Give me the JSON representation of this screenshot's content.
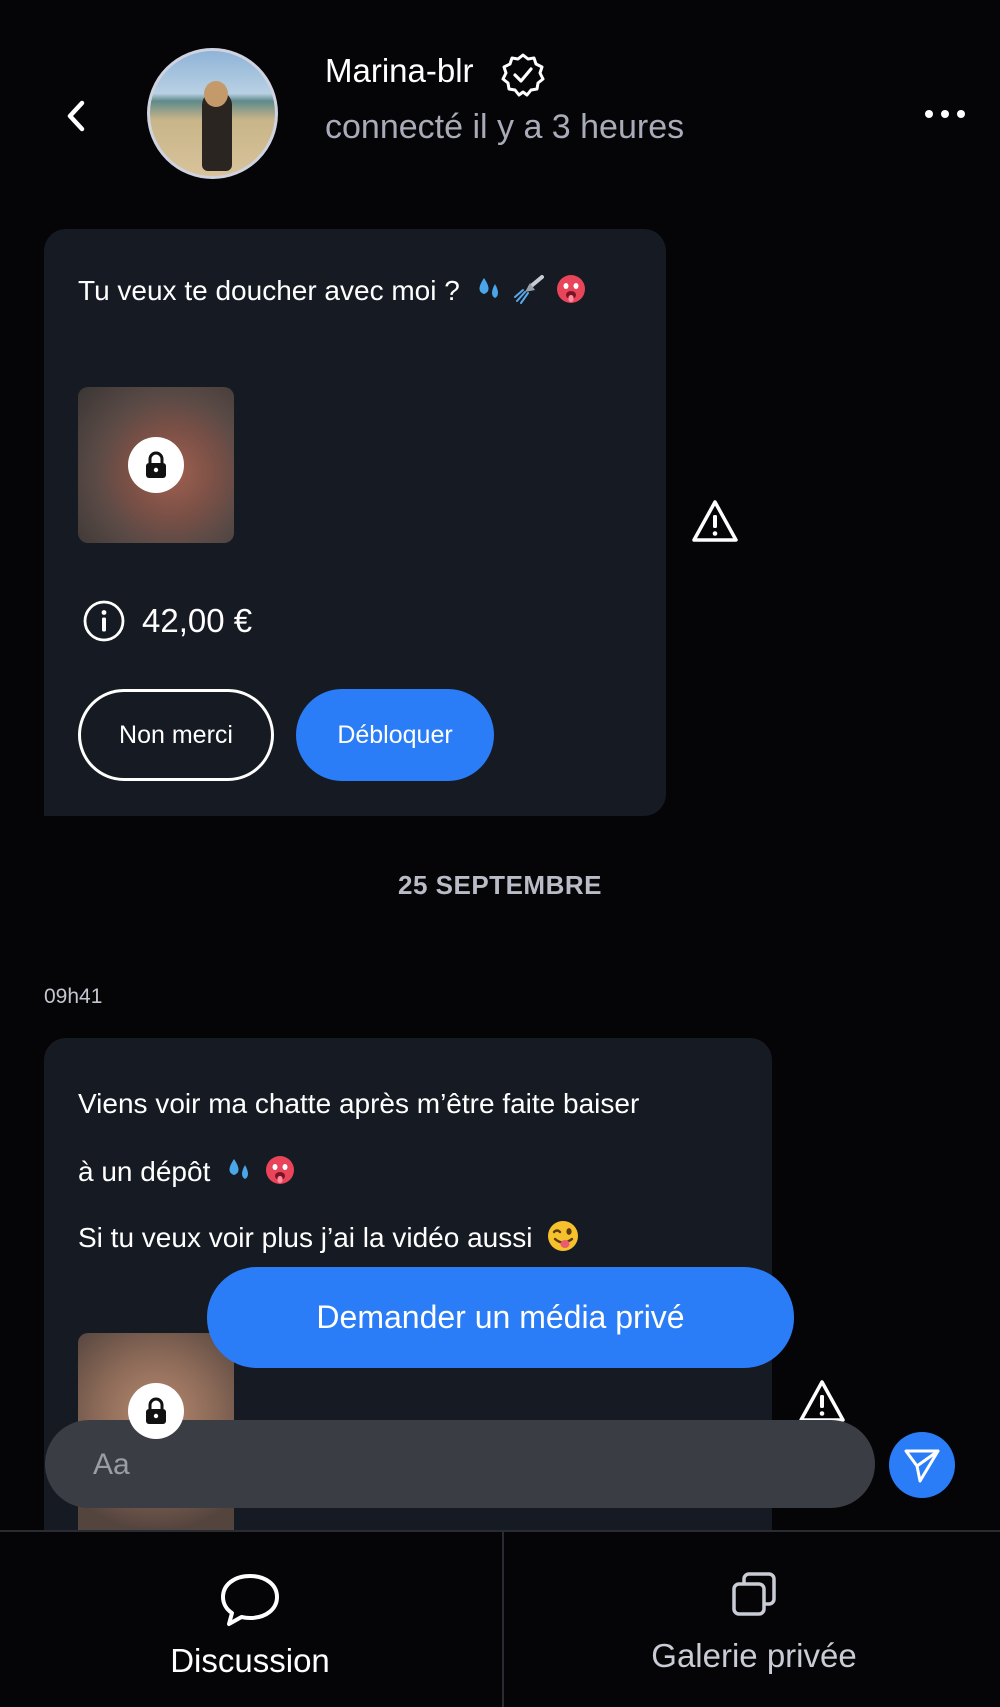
{
  "header": {
    "user_name": "Marina-blr",
    "status": "connecté il y a 3 heures"
  },
  "messages": [
    {
      "text": "Tu veux te doucher avec moi ?",
      "emojis": [
        "💦",
        "🚿",
        "🥵"
      ],
      "locked_media": true,
      "price": "42,00 €",
      "decline_label": "Non merci",
      "unlock_label": "Débloquer"
    }
  ],
  "date_separator": "25 SEPTEMBRE",
  "second_message": {
    "time": "09h41",
    "lines": [
      "Viens voir ma chatte après m’être faite baiser",
      "à un dépôt",
      "Si tu veux voir plus j’ai la vidéo aussi"
    ],
    "line2_emojis": [
      "💦",
      "🥵"
    ],
    "line3_emoji": "😜"
  },
  "request_button": "Demander un média privé",
  "composer": {
    "placeholder": "Aa"
  },
  "tabs": [
    {
      "label": "Discussion",
      "active": true,
      "icon": "chat-bubble-icon"
    },
    {
      "label": "Galerie privée",
      "active": false,
      "icon": "gallery-stack-icon"
    }
  ],
  "colors": {
    "accent": "#2b7df7",
    "bubble": "#161a22",
    "background": "#050508"
  }
}
